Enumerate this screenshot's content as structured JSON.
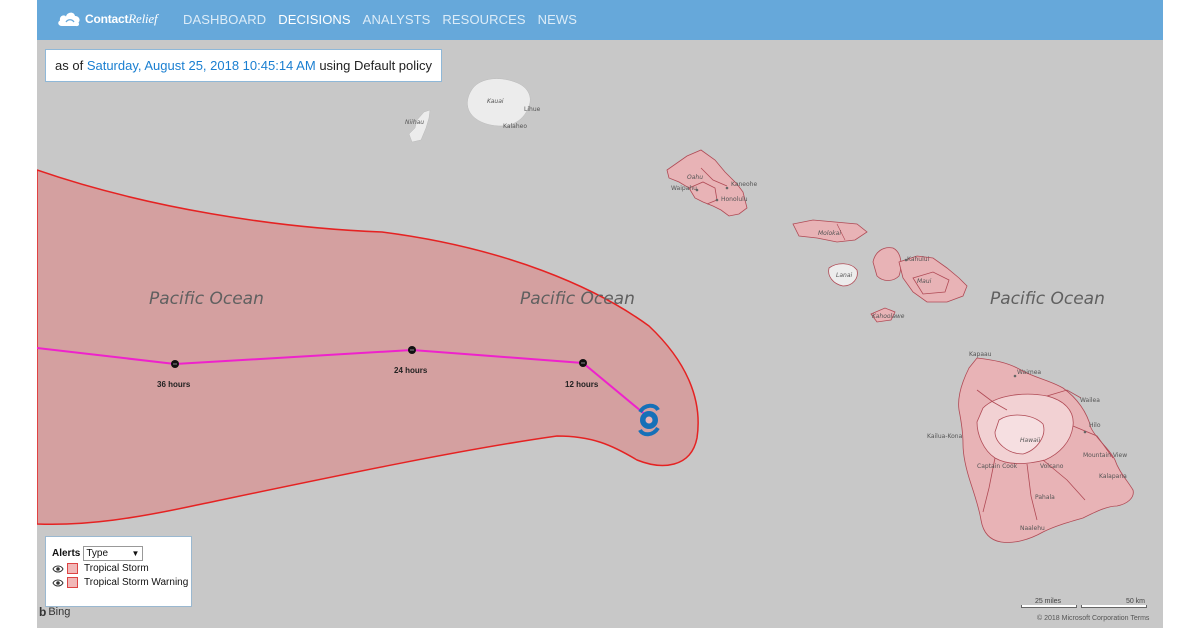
{
  "app": {
    "logo_bold": "Contact",
    "logo_italic": "Relief",
    "nav": [
      {
        "label": "DASHBOARD",
        "active": false
      },
      {
        "label": "DECISIONS",
        "active": true
      },
      {
        "label": "ANALYSTS",
        "active": false
      },
      {
        "label": "RESOURCES",
        "active": false
      },
      {
        "label": "NEWS",
        "active": false
      }
    ]
  },
  "asof": {
    "prefix": "as of",
    "datetime": "Saturday, August 25, 2018 10:45:14 AM",
    "suffix": "using Default policy"
  },
  "map": {
    "ocean_labels": [
      "Pacific Ocean",
      "Pacific Ocean",
      "Pacific Ocean"
    ],
    "island_labels": [
      "Kauai",
      "Niihau",
      "Oahu",
      "Molokai",
      "Lanai",
      "Maui",
      "Kahoolawe",
      "Hawaii"
    ],
    "place_labels": [
      "Lihue",
      "Kalaheo",
      "Waipahu",
      "Kaneohe",
      "Honolulu",
      "Kahului",
      "Kapaau",
      "Waimea",
      "Wailea",
      "Hilo",
      "Kailua-Kona",
      "Mountain View",
      "Captain Cook",
      "Volcano",
      "Kalapana",
      "Pahala",
      "Naalehu"
    ],
    "track_labels": [
      "36 hours",
      "24 hours",
      "12 hours"
    ],
    "colors": {
      "cone_fill": "#d4a0a0",
      "cone_stroke": "#e52222",
      "track": "#ee22cc",
      "island_alert": "#e8b3b6",
      "island_plain": "#ececec",
      "water": "#c8c8c8"
    }
  },
  "legend": {
    "title": "Alerts",
    "select_value": "Type",
    "items": [
      {
        "label": "Tropical Storm"
      },
      {
        "label": "Tropical Storm Warning"
      }
    ]
  },
  "footer": {
    "bing": "Bing",
    "scale_miles": "25 miles",
    "scale_km": "50 km",
    "copyright": "© 2018 Microsoft Corporation",
    "terms": "Terms"
  }
}
